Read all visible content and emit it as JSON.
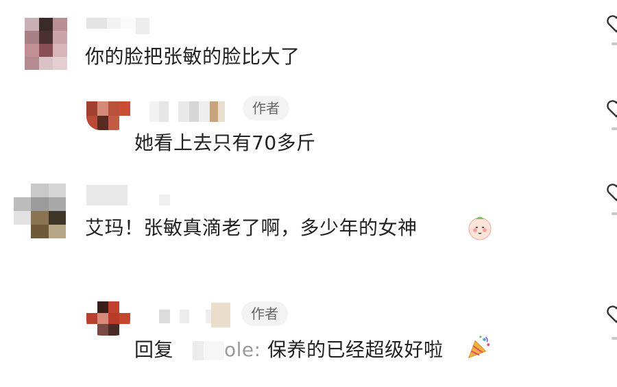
{
  "comments": [
    {
      "text": "你的脸把张敏的脸比大了"
    },
    {
      "text": "她看上去只有70多斤",
      "badge": "作者"
    },
    {
      "text": "艾玛！张敏真滴老了啊，多少年的女神",
      "emoji": "shy-face-emoji"
    },
    {
      "reply_prefix": "回复",
      "mention_tail": "ole:",
      "text": " 保养的已经超级好啦",
      "badge": "作者",
      "emoji": "party-popper-emoji"
    }
  ],
  "colors": {
    "text": "#222222",
    "badge_bg": "#f3f3f3",
    "badge_text": "#666666",
    "muted": "#9a9a9a"
  },
  "icons": [
    "heart-outline-icon"
  ]
}
